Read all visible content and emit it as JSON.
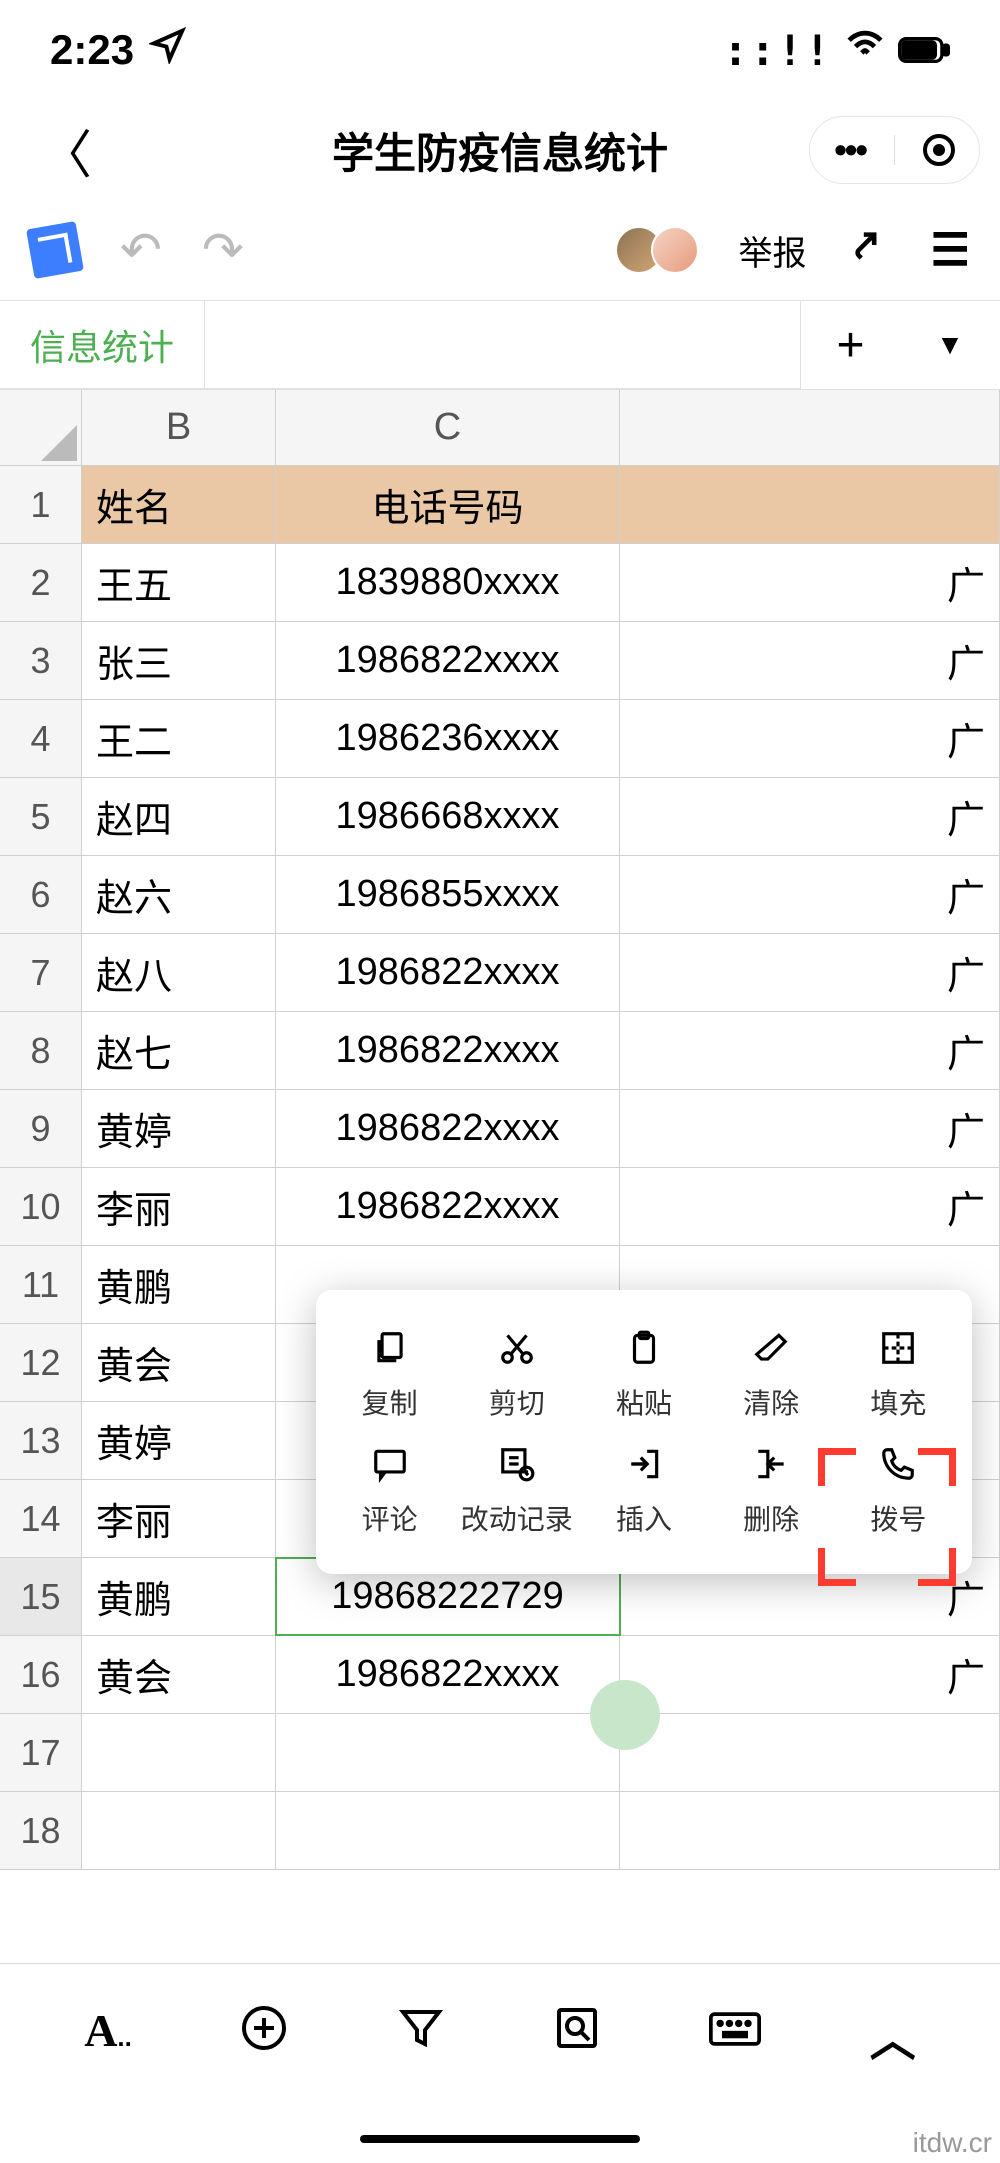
{
  "status": {
    "time": "2:23"
  },
  "header": {
    "title": "学生防疫信息统计"
  },
  "toolbar": {
    "report": "举报"
  },
  "tabs": {
    "active": "信息统计"
  },
  "columns": {
    "b": "B",
    "c": "C"
  },
  "table_header": {
    "name": "姓名",
    "phone": "电话号码"
  },
  "rows": [
    {
      "n": "1"
    },
    {
      "n": "2",
      "name": "王五",
      "phone": "1839880xxxx",
      "d": "广"
    },
    {
      "n": "3",
      "name": "张三",
      "phone": "1986822xxxx",
      "d": "广"
    },
    {
      "n": "4",
      "name": "王二",
      "phone": "1986236xxxx",
      "d": "广"
    },
    {
      "n": "5",
      "name": "赵四",
      "phone": "1986668xxxx",
      "d": "广"
    },
    {
      "n": "6",
      "name": "赵六",
      "phone": "1986855xxxx",
      "d": "广"
    },
    {
      "n": "7",
      "name": "赵八",
      "phone": "1986822xxxx",
      "d": "广"
    },
    {
      "n": "8",
      "name": "赵七",
      "phone": "1986822xxxx",
      "d": "广"
    },
    {
      "n": "9",
      "name": "黄婷",
      "phone": "1986822xxxx",
      "d": "广"
    },
    {
      "n": "10",
      "name": "李丽",
      "phone": "1986822xxxx",
      "d": "广"
    },
    {
      "n": "11",
      "name": "黄鹏",
      "phone": "",
      "d": ""
    },
    {
      "n": "12",
      "name": "黄会",
      "phone": "",
      "d": ""
    },
    {
      "n": "13",
      "name": "黄婷",
      "phone": "",
      "d": ""
    },
    {
      "n": "14",
      "name": "李丽",
      "phone": "",
      "d": ""
    },
    {
      "n": "15",
      "name": "黄鹏",
      "phone": "19868222729",
      "d": "广"
    },
    {
      "n": "16",
      "name": "黄会",
      "phone": "1986822xxxx",
      "d": "广"
    },
    {
      "n": "17"
    },
    {
      "n": "18"
    }
  ],
  "context_menu": {
    "copy": "复制",
    "cut": "剪切",
    "paste": "粘贴",
    "clear": "清除",
    "fill": "填充",
    "comment": "评论",
    "history": "改动记录",
    "insert": "插入",
    "delete": "删除",
    "dial": "拨号"
  },
  "watermark": "itdw.cr"
}
